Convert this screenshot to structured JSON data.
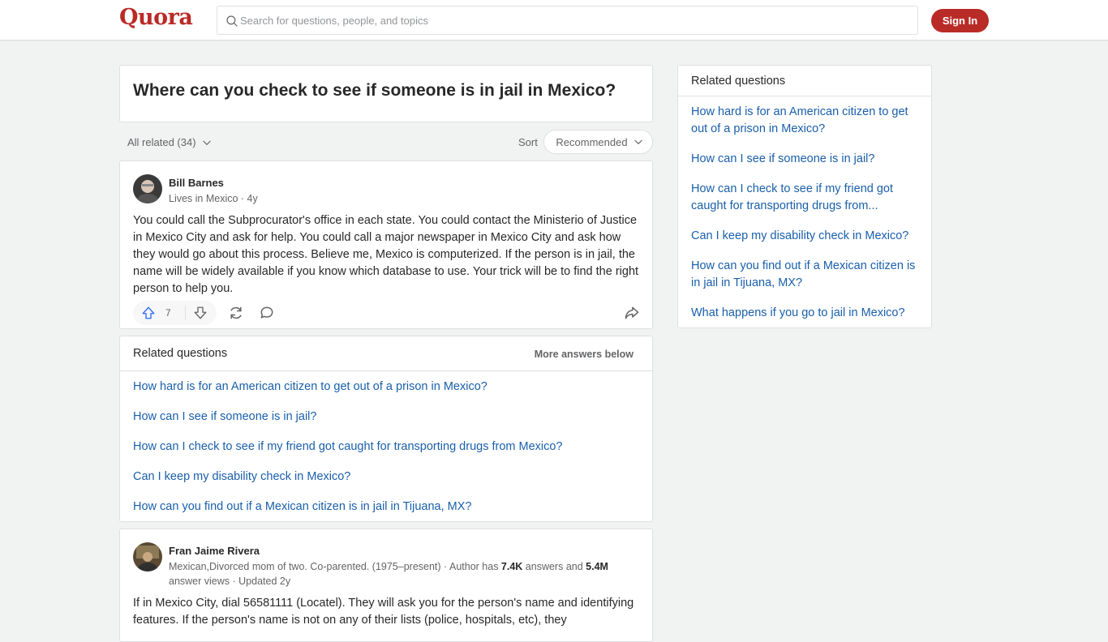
{
  "header": {
    "logo": "Quora",
    "search_placeholder": "Search for questions, people, and topics",
    "signin_label": "Sign In"
  },
  "question": {
    "title": "Where can you check to see if someone is in jail in Mexico?"
  },
  "filters": {
    "all_related": "All related (34)",
    "sort_label": "Sort",
    "sort_value": "Recommended"
  },
  "answers": [
    {
      "author": "Bill Barnes",
      "meta": "Lives in Mexico · 4y",
      "text": "You could call the Subprocurator's office in each state. You could contact the Ministerio of Justice in Mexico City and ask for help. You could call a major newspaper in Mexico City and ask how they would go about this process. Believe me, Mexico is computerized. If the person is in jail, the name will be widely available if you know which database to use. Your trick will be to find the right person to help you.",
      "upvotes": "7"
    },
    {
      "author": "Fran Jaime Rivera",
      "meta_prefix": "Mexican,Divorced mom of two. Co-parented. (1975–present) · Author has ",
      "meta_answers": "7.4K",
      "meta_mid": " answers and ",
      "meta_views": "5.4M",
      "meta_suffix": "answer views · Updated 2y",
      "text": "If in Mexico City, dial 56581111 (Locatel). They will ask you for the person's name and identifying features. If the person's name is not on any of their lists (police, hospitals, etc), they"
    }
  ],
  "related_inline": {
    "title": "Related questions",
    "more": "More answers below",
    "links": [
      "How hard is for an American citizen to get out of a prison in Mexico?",
      "How can I see if someone is in jail?",
      "How can I check to see if my friend got caught for transporting drugs from Mexico?",
      "Can I keep my disability check in Mexico?",
      "How can you find out if a Mexican citizen is in jail in Tijuana, MX?"
    ]
  },
  "sidebar": {
    "title": "Related questions",
    "links": [
      "How hard is for an American citizen to get out of a prison in Mexico?",
      "How can I see if someone is in jail?",
      "How can I check to see if my friend got caught for transporting drugs from...",
      "Can I keep my disability check in Mexico?",
      "How can you find out if a Mexican citizen is in jail in Tijuana, MX?",
      "What happens if you go to jail in Mexico?"
    ]
  },
  "colors": {
    "brand": "#b92b27",
    "link": "#195faa",
    "upvote": "#2e69ff"
  }
}
